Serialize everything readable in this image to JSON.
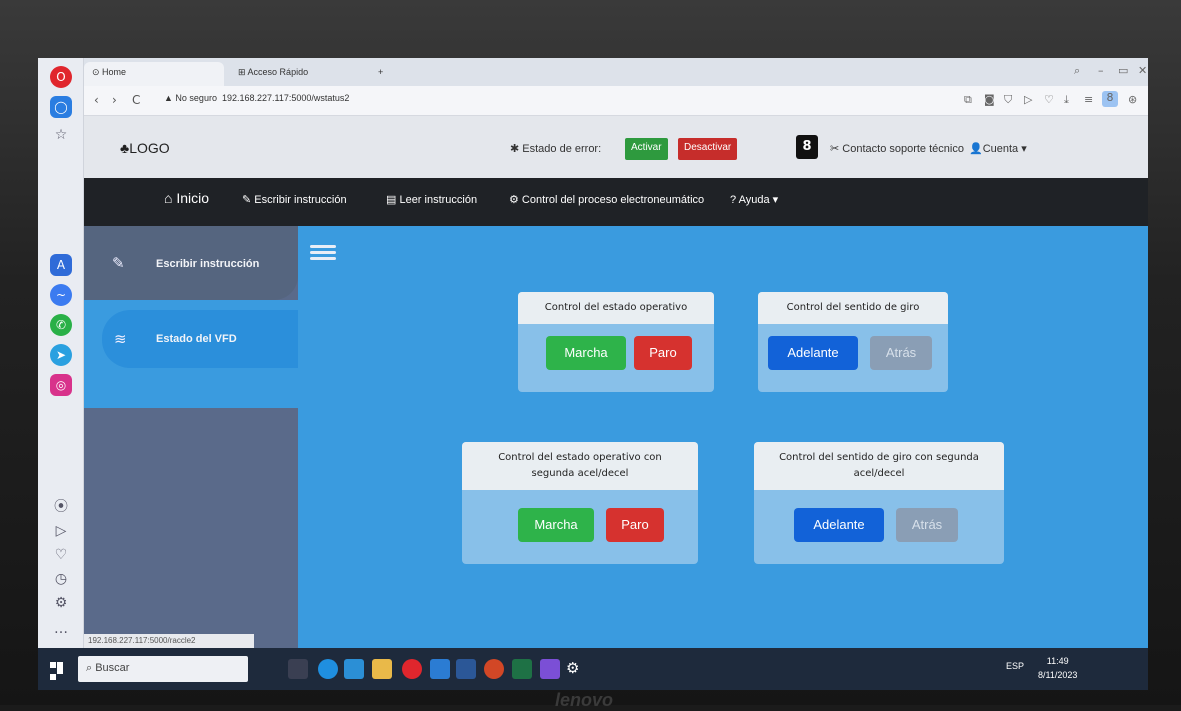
{
  "browser": {
    "tabs": [
      {
        "label": "Home"
      },
      {
        "label": "Acceso Rápido"
      }
    ],
    "new_tab": "+",
    "security": "No seguro",
    "url": "192.168.227.117:5000/wstatus2",
    "status_url": "192.168.227.117:5000/raccle2"
  },
  "header": {
    "logo": "LOGO",
    "error_label": "Estado de error:",
    "activate": "Activar",
    "deactivate": "Desactivar",
    "badge": "8",
    "support": "Contacto soporte técnico",
    "account": "Cuenta"
  },
  "navbar": {
    "home": "Inicio",
    "write": "Escribir instrucción",
    "read": "Leer instrucción",
    "control": "Control del proceso electroneumático",
    "help": "? Ayuda"
  },
  "sidebar": {
    "items": [
      {
        "label": "Escribir instrucción"
      },
      {
        "label": "Estado del VFD"
      }
    ]
  },
  "cards": [
    {
      "title": "Control del estado operativo",
      "b1": "Marcha",
      "b2": "Paro"
    },
    {
      "title": "Control del sentido de giro",
      "b1": "Adelante",
      "b2": "Atrás"
    },
    {
      "title": "Control del estado operativo con segunda acel/decel",
      "b1": "Marcha",
      "b2": "Paro"
    },
    {
      "title": "Control del sentido de giro con segunda acel/decel",
      "b1": "Adelante",
      "b2": "Atrás"
    }
  ],
  "taskbar": {
    "search": "Buscar",
    "lang": "ESP",
    "time": "11:49",
    "date": "8/11/2023"
  },
  "bezel_brand": "lenovo"
}
